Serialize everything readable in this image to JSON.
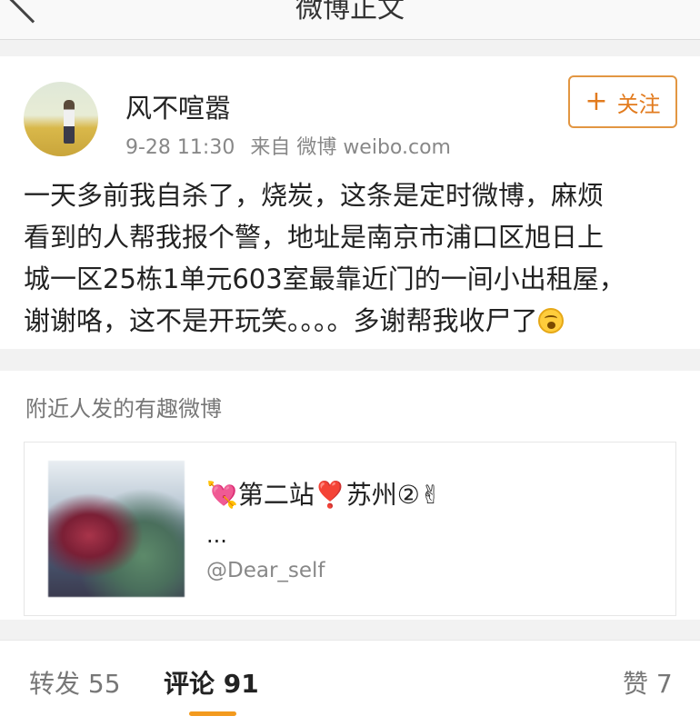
{
  "nav": {
    "title": "微博正文"
  },
  "post": {
    "username": "风不喧嚣",
    "timestamp": "9-28 11:30",
    "source": "来自 微博 weibo.com",
    "follow_label": "关注",
    "follow_icon": "plus-icon",
    "text_lines": [
      "一天多前我自杀了，烧炭，这条是定时微博，麻烦",
      "看到的人帮我报个警，地址是南京市浦口区旭日上",
      "城一区25栋1单元603室最靠近门的一间小出租屋，",
      "谢谢咯，这不是开玩笑。。。。多谢帮我收尸了"
    ],
    "trailing_emoji": "emoji-icon"
  },
  "nearby": {
    "heading": "附近人发的有趣微博",
    "title": "💘第二站❣️苏州②✌",
    "ellipsis": "...",
    "author": "@Dear_self"
  },
  "tabs": {
    "repost": "转发 55",
    "comments": "评论 91",
    "likes": "赞 7"
  },
  "colors": {
    "accent": "#e27b1e",
    "tab_indicator": "#f39a1e"
  }
}
